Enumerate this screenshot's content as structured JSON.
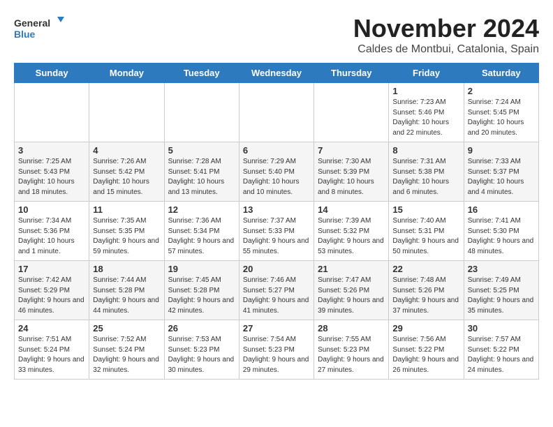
{
  "logo": {
    "line1": "General",
    "line2": "Blue"
  },
  "title": "November 2024",
  "location": "Caldes de Montbui, Catalonia, Spain",
  "days_of_week": [
    "Sunday",
    "Monday",
    "Tuesday",
    "Wednesday",
    "Thursday",
    "Friday",
    "Saturday"
  ],
  "weeks": [
    [
      {
        "day": "",
        "info": ""
      },
      {
        "day": "",
        "info": ""
      },
      {
        "day": "",
        "info": ""
      },
      {
        "day": "",
        "info": ""
      },
      {
        "day": "",
        "info": ""
      },
      {
        "day": "1",
        "info": "Sunrise: 7:23 AM\nSunset: 5:46 PM\nDaylight: 10 hours and 22 minutes."
      },
      {
        "day": "2",
        "info": "Sunrise: 7:24 AM\nSunset: 5:45 PM\nDaylight: 10 hours and 20 minutes."
      }
    ],
    [
      {
        "day": "3",
        "info": "Sunrise: 7:25 AM\nSunset: 5:43 PM\nDaylight: 10 hours and 18 minutes."
      },
      {
        "day": "4",
        "info": "Sunrise: 7:26 AM\nSunset: 5:42 PM\nDaylight: 10 hours and 15 minutes."
      },
      {
        "day": "5",
        "info": "Sunrise: 7:28 AM\nSunset: 5:41 PM\nDaylight: 10 hours and 13 minutes."
      },
      {
        "day": "6",
        "info": "Sunrise: 7:29 AM\nSunset: 5:40 PM\nDaylight: 10 hours and 10 minutes."
      },
      {
        "day": "7",
        "info": "Sunrise: 7:30 AM\nSunset: 5:39 PM\nDaylight: 10 hours and 8 minutes."
      },
      {
        "day": "8",
        "info": "Sunrise: 7:31 AM\nSunset: 5:38 PM\nDaylight: 10 hours and 6 minutes."
      },
      {
        "day": "9",
        "info": "Sunrise: 7:33 AM\nSunset: 5:37 PM\nDaylight: 10 hours and 4 minutes."
      }
    ],
    [
      {
        "day": "10",
        "info": "Sunrise: 7:34 AM\nSunset: 5:36 PM\nDaylight: 10 hours and 1 minute."
      },
      {
        "day": "11",
        "info": "Sunrise: 7:35 AM\nSunset: 5:35 PM\nDaylight: 9 hours and 59 minutes."
      },
      {
        "day": "12",
        "info": "Sunrise: 7:36 AM\nSunset: 5:34 PM\nDaylight: 9 hours and 57 minutes."
      },
      {
        "day": "13",
        "info": "Sunrise: 7:37 AM\nSunset: 5:33 PM\nDaylight: 9 hours and 55 minutes."
      },
      {
        "day": "14",
        "info": "Sunrise: 7:39 AM\nSunset: 5:32 PM\nDaylight: 9 hours and 53 minutes."
      },
      {
        "day": "15",
        "info": "Sunrise: 7:40 AM\nSunset: 5:31 PM\nDaylight: 9 hours and 50 minutes."
      },
      {
        "day": "16",
        "info": "Sunrise: 7:41 AM\nSunset: 5:30 PM\nDaylight: 9 hours and 48 minutes."
      }
    ],
    [
      {
        "day": "17",
        "info": "Sunrise: 7:42 AM\nSunset: 5:29 PM\nDaylight: 9 hours and 46 minutes."
      },
      {
        "day": "18",
        "info": "Sunrise: 7:44 AM\nSunset: 5:28 PM\nDaylight: 9 hours and 44 minutes."
      },
      {
        "day": "19",
        "info": "Sunrise: 7:45 AM\nSunset: 5:28 PM\nDaylight: 9 hours and 42 minutes."
      },
      {
        "day": "20",
        "info": "Sunrise: 7:46 AM\nSunset: 5:27 PM\nDaylight: 9 hours and 41 minutes."
      },
      {
        "day": "21",
        "info": "Sunrise: 7:47 AM\nSunset: 5:26 PM\nDaylight: 9 hours and 39 minutes."
      },
      {
        "day": "22",
        "info": "Sunrise: 7:48 AM\nSunset: 5:26 PM\nDaylight: 9 hours and 37 minutes."
      },
      {
        "day": "23",
        "info": "Sunrise: 7:49 AM\nSunset: 5:25 PM\nDaylight: 9 hours and 35 minutes."
      }
    ],
    [
      {
        "day": "24",
        "info": "Sunrise: 7:51 AM\nSunset: 5:24 PM\nDaylight: 9 hours and 33 minutes."
      },
      {
        "day": "25",
        "info": "Sunrise: 7:52 AM\nSunset: 5:24 PM\nDaylight: 9 hours and 32 minutes."
      },
      {
        "day": "26",
        "info": "Sunrise: 7:53 AM\nSunset: 5:23 PM\nDaylight: 9 hours and 30 minutes."
      },
      {
        "day": "27",
        "info": "Sunrise: 7:54 AM\nSunset: 5:23 PM\nDaylight: 9 hours and 29 minutes."
      },
      {
        "day": "28",
        "info": "Sunrise: 7:55 AM\nSunset: 5:23 PM\nDaylight: 9 hours and 27 minutes."
      },
      {
        "day": "29",
        "info": "Sunrise: 7:56 AM\nSunset: 5:22 PM\nDaylight: 9 hours and 26 minutes."
      },
      {
        "day": "30",
        "info": "Sunrise: 7:57 AM\nSunset: 5:22 PM\nDaylight: 9 hours and 24 minutes."
      }
    ]
  ]
}
